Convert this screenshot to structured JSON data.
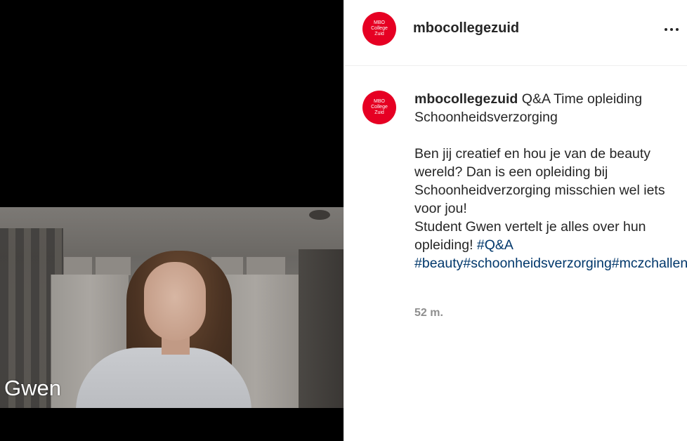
{
  "post": {
    "username": "mbocollegezuid",
    "avatar_lines": [
      "MBO",
      "College",
      "Zuid"
    ],
    "more_icon": "more-horizontal-icon",
    "colors": {
      "avatar": "#e60023",
      "hashtag": "#00376b",
      "text": "#262626",
      "meta": "#8e8e8e"
    }
  },
  "media": {
    "name_label": "Gwen"
  },
  "caption": {
    "username": "mbocollegezuid",
    "title": "Q&A Time opleiding Schoonheidsverzorging",
    "body_line1": "Ben jij creatief en hou je van de beauty wereld? Dan is een opleiding bij Schoonheidverzorging misschien wel iets voor jou!",
    "body_line2": "Student Gwen vertelt je alles over hun opleiding!",
    "hashtags": [
      "#Q&A",
      "#beauty",
      "#schoonheidsverzorging",
      "#mczchallenge"
    ],
    "timestamp": "52 m."
  }
}
